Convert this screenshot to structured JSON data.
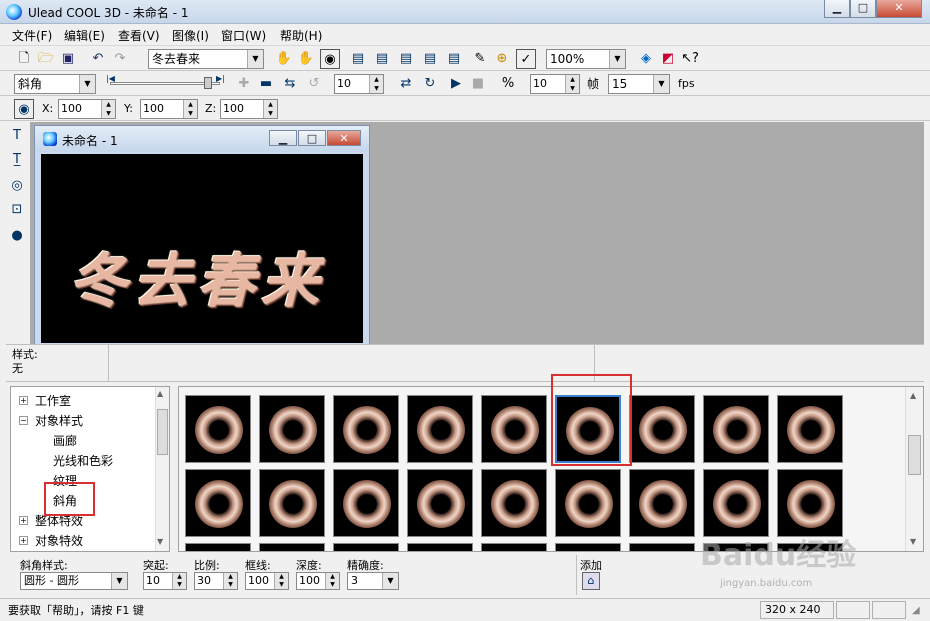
{
  "app": {
    "title": "Ulead COOL 3D - 未命名 - 1",
    "min_glyph": "▁",
    "max_glyph": "□",
    "close_glyph": "✕"
  },
  "menu": [
    "文件(F)",
    "编辑(E)",
    "查看(V)",
    "图像(I)",
    "窗口(W)",
    "帮助(H)"
  ],
  "toolbar1": {
    "text_combo": "冬去春来",
    "zoom_combo": "100%"
  },
  "toolbar2": {
    "effect_combo": "斜角",
    "frame_value": "10",
    "frames_value": "10",
    "frame_label": "帧",
    "fps_value": "15",
    "fps_label": "fps"
  },
  "toolbar3": {
    "x_label": "X:",
    "x_value": "100",
    "y_label": "Y:",
    "y_value": "100",
    "z_label": "Z:",
    "z_value": "100"
  },
  "document": {
    "title": "未命名 - 1",
    "canvas_text": "冬去春来"
  },
  "style_panel": {
    "label": "样式:",
    "value": "无"
  },
  "tree": {
    "items": [
      {
        "label": "工作室",
        "expand": "+"
      },
      {
        "label": "对象样式",
        "expand": "−"
      },
      {
        "label": "画廊"
      },
      {
        "label": "光线和色彩"
      },
      {
        "label": "纹理"
      },
      {
        "label": "斜角"
      },
      {
        "label": "整体特效",
        "expand": "+"
      },
      {
        "label": "对象特效",
        "expand": "+"
      }
    ]
  },
  "props": {
    "bevel_style_label": "斜角样式:",
    "bevel_style_value": "圆形 - 圆形",
    "protrude_label": "突起:",
    "protrude_value": "10",
    "ratio_label": "比例:",
    "ratio_value": "30",
    "border_label": "框线:",
    "border_value": "100",
    "depth_label": "深度:",
    "depth_value": "100",
    "precision_label": "精确度:",
    "precision_value": "3",
    "add_label": "添加"
  },
  "status": {
    "help_text": "要获取「帮助」，请按 F1 键",
    "size": "320 x 240"
  },
  "watermark": {
    "brand": "Baidu经验",
    "url": "jingyan.baidu.com"
  },
  "colors": {
    "highlight_red": "#d83030",
    "workspace_gray": "#ababab"
  }
}
